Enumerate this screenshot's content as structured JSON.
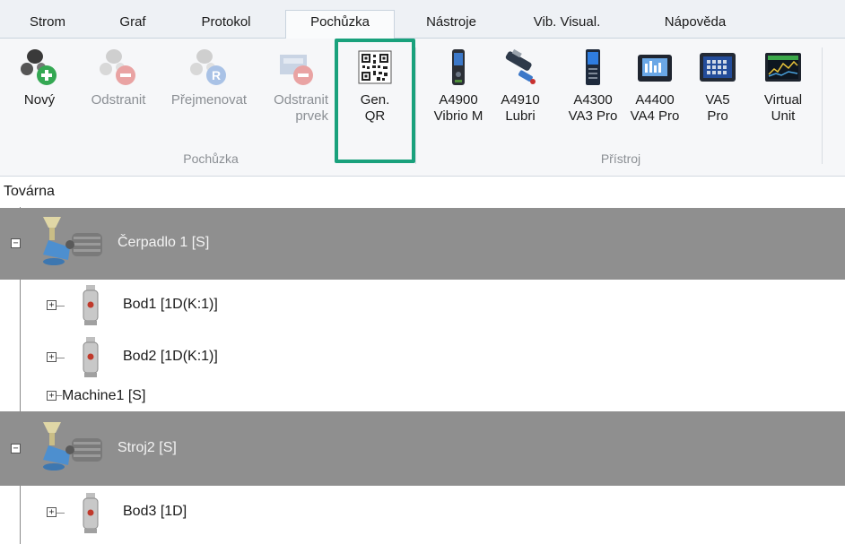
{
  "tabs": [
    {
      "label": "Strom",
      "active": false
    },
    {
      "label": "Graf",
      "active": false
    },
    {
      "label": "Protokol",
      "active": false
    },
    {
      "label": "Pochůzka",
      "active": true
    },
    {
      "label": "Nástroje",
      "active": false
    },
    {
      "label": "Vib. Visual.",
      "active": false
    },
    {
      "label": "Nápověda",
      "active": false
    }
  ],
  "ribbon": {
    "pochuzka_group": {
      "label": "Pochůzka",
      "buttons": [
        {
          "line1": "Nový",
          "line2": "",
          "enabled": true,
          "icon": "route-add-icon"
        },
        {
          "line1": "Odstranit",
          "line2": "",
          "enabled": false,
          "icon": "route-remove-icon"
        },
        {
          "line1": "Přejmenovat",
          "line2": "",
          "enabled": false,
          "icon": "route-rename-icon"
        },
        {
          "line1": "Odstranit",
          "line2": "prvek",
          "enabled": false,
          "icon": "element-remove-icon"
        },
        {
          "line1": "Gen.",
          "line2": "QR",
          "enabled": true,
          "icon": "qr-code-icon"
        }
      ]
    },
    "pristroj_group": {
      "label": "Přístroj",
      "buttons": [
        {
          "line1": "A4900",
          "line2": "Vibrio M",
          "icon": "vibrio-device-icon"
        },
        {
          "line1": "A4910",
          "line2": "Lubri",
          "icon": "lubri-device-icon"
        },
        {
          "line1": "A4300",
          "line2": "VA3 Pro",
          "icon": "va3-device-icon"
        },
        {
          "line1": "A4400",
          "line2": "VA4 Pro",
          "icon": "va4-device-icon"
        },
        {
          "line1": "VA5",
          "line2": "Pro",
          "icon": "va5-device-icon"
        },
        {
          "line1": "Virtual",
          "line2": "Unit",
          "icon": "virtual-unit-icon"
        }
      ]
    }
  },
  "tree": {
    "root": "Továrna",
    "nodes": [
      {
        "label": "Čerpadlo 1 [S]",
        "type": "machine",
        "expanded": true,
        "selected": true
      },
      {
        "label": "Bod1 [1D(K:1)]",
        "type": "point",
        "expanded": false
      },
      {
        "label": "Bod2 [1D(K:1)]",
        "type": "point",
        "expanded": false
      },
      {
        "label": "Machine1 [S]",
        "type": "machine-noicon",
        "expanded": false
      },
      {
        "label": "Stroj2 [S]",
        "type": "machine",
        "expanded": true,
        "selected": true
      },
      {
        "label": "Bod3 [1D]",
        "type": "point",
        "expanded": false
      }
    ]
  },
  "colors": {
    "highlight_frame": "#19a17c",
    "selected_row": "#8f8f8f",
    "disabled_text": "#8b8f94"
  }
}
